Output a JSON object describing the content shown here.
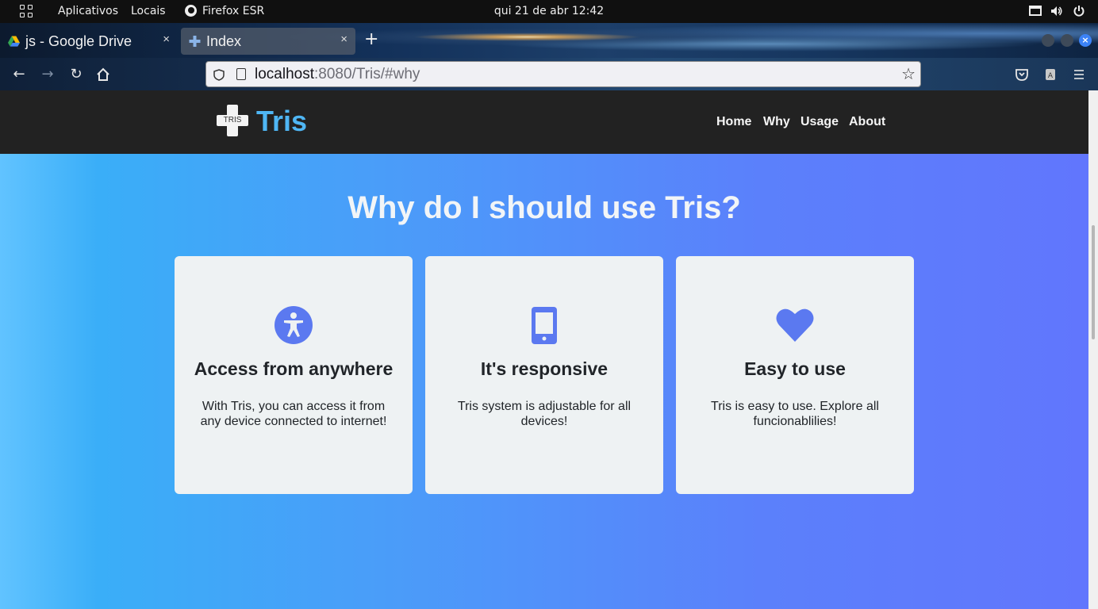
{
  "system_bar": {
    "apps_label": "Aplicativos",
    "places_label": "Locais",
    "active_app": "Firefox ESR",
    "clock": "qui 21 de abr  12:42"
  },
  "browser": {
    "tabs": [
      {
        "title": "js - Google Drive",
        "close": "×"
      },
      {
        "title": "Index",
        "close": "×"
      }
    ],
    "new_tab": "+",
    "url_host": "localhost",
    "url_rest": ":8080/Tris/#why"
  },
  "site": {
    "logo_text": "TRIS",
    "brand": "Tris",
    "nav": [
      "Home",
      "Why",
      "Usage",
      "About"
    ],
    "section_title": "Why do I should use Tris?",
    "cards": [
      {
        "icon": "accessibility-icon",
        "title": "Access from anywhere",
        "text": "With Tris, you can access it from any device connected to internet!"
      },
      {
        "icon": "mobile-phone-icon",
        "title": "It's responsive",
        "text": "Tris system is adjustable for all devices!"
      },
      {
        "icon": "heart-icon",
        "title": "Easy to use",
        "text": "Tris is easy to use. Explore all funcionablilies!"
      }
    ],
    "accent_color": "#5b79f0",
    "brand_color": "#4fb6f4"
  }
}
